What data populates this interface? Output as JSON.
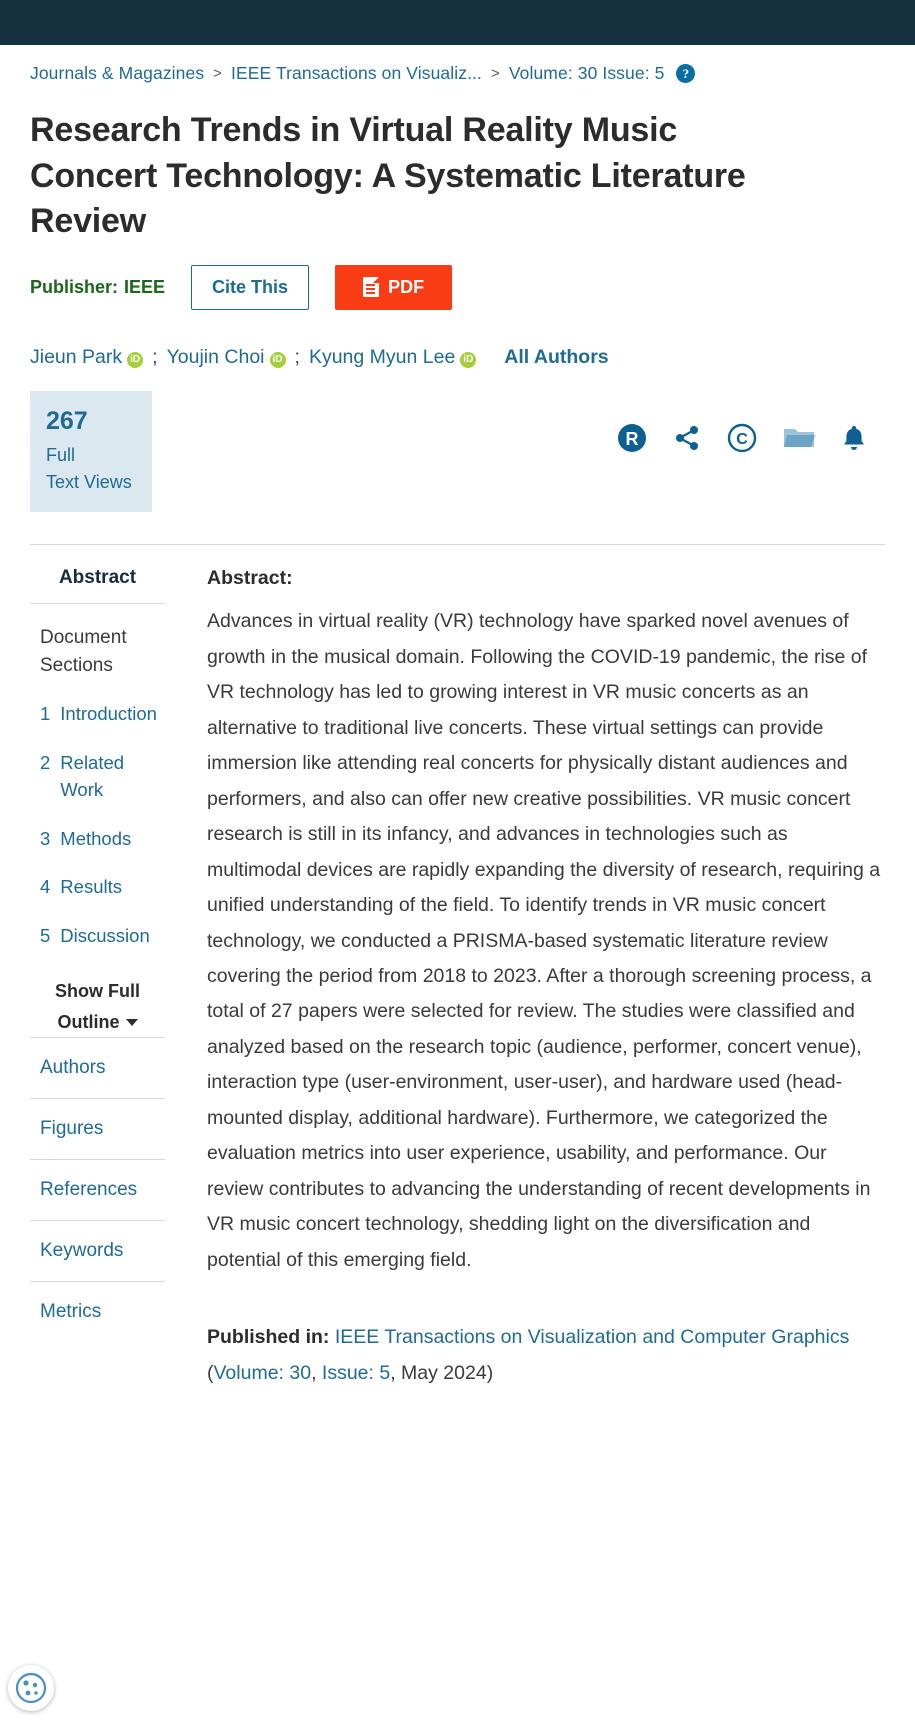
{
  "breadcrumb": {
    "items": [
      {
        "label": "Journals & Magazines"
      },
      {
        "label": "IEEE Transactions on Visualiz..."
      },
      {
        "label": "Volume: 30 Issue: 5"
      }
    ],
    "separator": ">",
    "help_icon": "help-icon",
    "help_label": "?"
  },
  "document": {
    "title": "Research Trends in Virtual Reality Music Concert Technology: A Systematic Literature Review",
    "publisher_label": "Publisher:",
    "publisher_name": "IEEE",
    "cite_button": "Cite This",
    "pdf_button": "PDF"
  },
  "authors": {
    "list": [
      {
        "name": "Jieun Park",
        "orcid": "iD"
      },
      {
        "name": "Youjin Choi",
        "orcid": "iD"
      },
      {
        "name": "Kyung Myun Lee",
        "orcid": "iD"
      }
    ],
    "separator": ";",
    "all_authors_label": "All Authors"
  },
  "stats": {
    "views_count": "267",
    "views_line1": "Full",
    "views_line2": "Text Views"
  },
  "action_icons": [
    {
      "name": "researchgate-icon",
      "glyph": "R"
    },
    {
      "name": "share-icon",
      "glyph": "share"
    },
    {
      "name": "copyright-icon",
      "glyph": "C"
    },
    {
      "name": "folder-icon",
      "glyph": "folder"
    },
    {
      "name": "alerts-bell-icon",
      "glyph": "bell"
    }
  ],
  "sidebar": {
    "abstract_tab": "Abstract",
    "document_sections_label": "Document Sections",
    "sections": [
      {
        "num": "1",
        "label": "Introduction"
      },
      {
        "num": "2",
        "label": "Related Work"
      },
      {
        "num": "3",
        "label": "Methods"
      },
      {
        "num": "4",
        "label": "Results"
      },
      {
        "num": "5",
        "label": "Discussion"
      }
    ],
    "show_full_outline": "Show Full Outline",
    "links": [
      {
        "label": "Authors"
      },
      {
        "label": "Figures"
      },
      {
        "label": "References"
      },
      {
        "label": "Keywords"
      },
      {
        "label": "Metrics"
      }
    ]
  },
  "abstract": {
    "label": "Abstract:",
    "text": "Advances in virtual reality (VR) technology have sparked novel avenues of growth in the musical domain. Following the COVID-19 pandemic, the rise of VR technology has led to growing interest in VR music concerts as an alternative to traditional live concerts. These virtual settings can provide immersion like attending real concerts for physically distant audiences and performers, and also can offer new creative possibilities. VR music concert research is still in its infancy, and advances in technologies such as multimodal devices are rapidly expanding the diversity of research, requiring a unified understanding of the field. To identify trends in VR music concert technology, we conducted a PRISMA-based systematic literature review covering the period from 2018 to 2023. After a thorough screening process, a total of 27 papers were selected for review. The studies were classified and analyzed based on the research topic (audience, performer, concert venue), interaction type (user-environment, user-user), and hardware used (head-mounted display, additional hardware). Furthermore, we categorized the evaluation metrics into user experience, usability, and performance. Our review contributes to advancing the understanding of recent developments in VR music concert technology, shedding light on the diversification and potential of this emerging field."
  },
  "published_in": {
    "label": "Published in:",
    "journal": "IEEE Transactions on Visualization and Computer Graphics",
    "open_paren": "(",
    "volume_label": "Volume: 30",
    "comma": ",",
    "issue_label": "Issue: 5",
    "date": ", May 2024)"
  },
  "colors": {
    "topbar": "#15313f",
    "link_blue": "#1f6b93",
    "publisher_green": "#1a661a",
    "pdf_orange": "#f93c13",
    "views_bg": "#dbe8ef",
    "orcid_green": "#a6ce39"
  }
}
